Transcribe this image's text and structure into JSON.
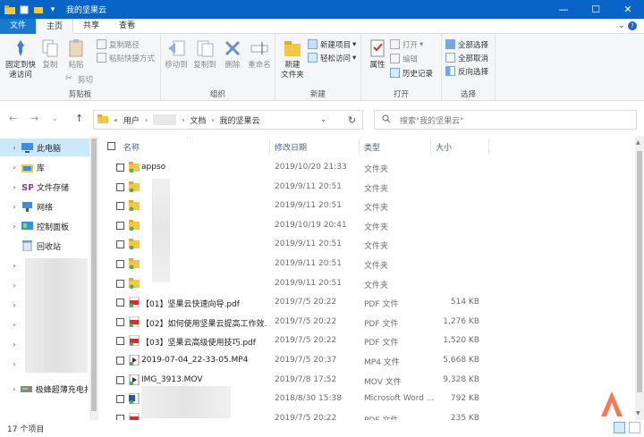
{
  "window": {
    "title": "我的坚果云",
    "controls": {
      "minimize": "—",
      "maximize": "☐",
      "close": "✕"
    }
  },
  "tabs": [
    {
      "label": "文件"
    },
    {
      "label": "主页"
    },
    {
      "label": "共享"
    },
    {
      "label": "查看"
    }
  ],
  "ribbon": {
    "clipboard": {
      "label": "剪贴板",
      "pin": "固定到快\n速访问",
      "copy": "复制",
      "paste": "粘贴",
      "copy_path": "复制路径",
      "paste_shortcut": "粘贴快捷方式",
      "cut": "剪切"
    },
    "organize": {
      "label": "组织",
      "move_to": "移动到",
      "copy_to": "复制到",
      "delete": "删除",
      "rename": "重命名"
    },
    "new": {
      "label": "新建",
      "new_folder": "新建\n文件夹",
      "new_item": "新建项目",
      "easy_access": "轻松访问"
    },
    "open": {
      "label": "打开",
      "properties": "属性",
      "open": "打开",
      "edit": "编辑",
      "history": "历史记录"
    },
    "select": {
      "label": "选择",
      "select_all": "全部选择",
      "select_none": "全部取消",
      "invert": "反向选择"
    }
  },
  "address": {
    "prefix": "«",
    "crumbs": [
      "用户",
      "文档",
      "我的坚果云"
    ],
    "search_placeholder": "搜索\"我的坚果云\""
  },
  "sidebar": {
    "items": [
      {
        "label": "此电脑",
        "icon": "computer-icon",
        "selected": true
      },
      {
        "label": "库",
        "icon": "library-icon"
      },
      {
        "label": "文件存储",
        "icon": "storage-icon"
      },
      {
        "label": "网络",
        "icon": "network-icon"
      },
      {
        "label": "控制面板",
        "icon": "control-panel-icon"
      },
      {
        "label": "回收站",
        "icon": "recycle-bin-icon"
      },
      {
        "label": "极蜂超薄充电扌",
        "icon": "drive-icon"
      }
    ]
  },
  "columns": {
    "name": "名称",
    "date": "修改日期",
    "type": "类型",
    "size": "大小"
  },
  "files": [
    {
      "name": "appso",
      "date": "2019/10/20 21:33",
      "type": "文件夹",
      "size": "",
      "icon": "folder"
    },
    {
      "name": "",
      "date": "2019/9/11 20:51",
      "type": "文件夹",
      "size": "",
      "icon": "folder"
    },
    {
      "name": "",
      "date": "2019/9/11 20:51",
      "type": "文件夹",
      "size": "",
      "icon": "folder"
    },
    {
      "name": "",
      "date": "2019/10/19 20:41",
      "type": "文件夹",
      "size": "",
      "icon": "folder"
    },
    {
      "name": "",
      "date": "2019/9/11 20:51",
      "type": "文件夹",
      "size": "",
      "icon": "folder"
    },
    {
      "name": "",
      "date": "2019/9/11 20:51",
      "type": "文件夹",
      "size": "",
      "icon": "folder"
    },
    {
      "name": "",
      "date": "2019/9/11 20:51",
      "type": "文件夹",
      "size": "",
      "icon": "folder"
    },
    {
      "name": "【01】坚果云快速向导.pdf",
      "date": "2019/7/5 20:22",
      "type": "PDF 文件",
      "size": "514 KB",
      "icon": "pdf"
    },
    {
      "name": "【02】如何使用坚果云提高工作效...",
      "date": "2019/7/5 20:22",
      "type": "PDF 文件",
      "size": "1,276 KB",
      "icon": "pdf"
    },
    {
      "name": "【03】坚果云高级使用技巧.pdf",
      "date": "2019/7/5 20:22",
      "type": "PDF 文件",
      "size": "1,520 KB",
      "icon": "pdf"
    },
    {
      "name": "2019-07-04_22-33-05.MP4",
      "date": "2019/7/5 20:37",
      "type": "MP4 文件",
      "size": "5,668 KB",
      "icon": "video"
    },
    {
      "name": "IMG_3913.MOV",
      "date": "2019/7/8 17:52",
      "type": "MOV 文件",
      "size": "9,328 KB",
      "icon": "video"
    },
    {
      "name": "",
      "date": "2018/8/30 15:38",
      "type": "Microsoft Word ...",
      "size": "792 KB",
      "icon": "word"
    },
    {
      "name": "",
      "date": "2019/7/5 20:22",
      "type": "PDF 文件",
      "size": "235 KB",
      "icon": "pdf"
    }
  ],
  "status": {
    "count": "17 个项目"
  },
  "colors": {
    "titlebar": "#0a64c8",
    "file_tab": "#1979ca",
    "selection": "#cce8ff",
    "folder": "#f5c748",
    "sync_badge": "#4caf50",
    "pdf": "#d32f2f"
  }
}
